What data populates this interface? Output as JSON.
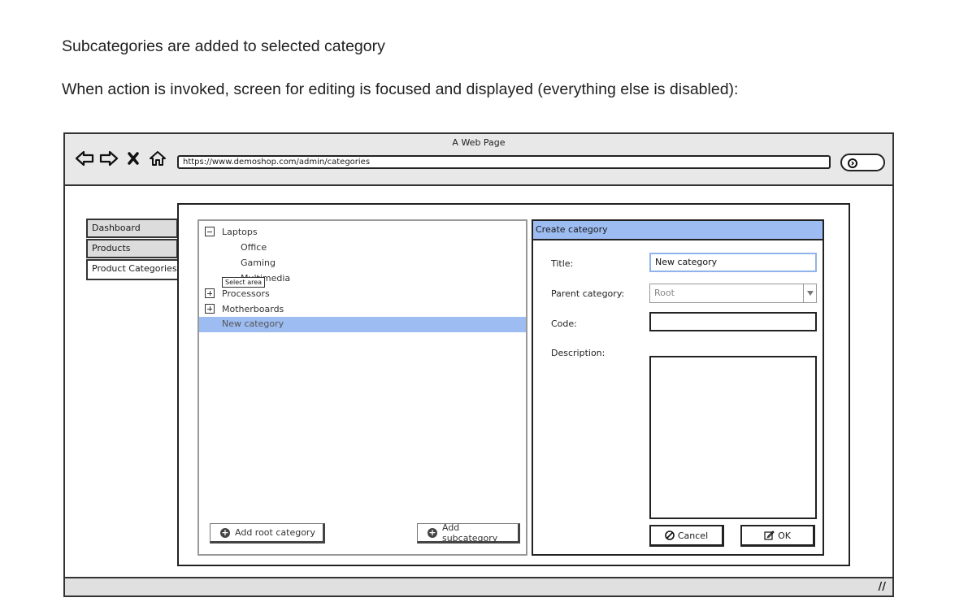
{
  "document": {
    "para1": "Subcategories are added to selected category",
    "para2": "When action is invoked, screen for editing is focused and displayed (everything else is disabled):"
  },
  "browser": {
    "title": "A Web Page",
    "url": "https://www.demoshop.com/admin/categories",
    "nav_icons": [
      "back-arrow-icon",
      "forward-arrow-icon",
      "close-x-icon",
      "home-icon"
    ],
    "resize_grip": "//"
  },
  "sidebar": {
    "tabs": [
      {
        "label": "Dashboard",
        "active": false
      },
      {
        "label": "Products",
        "active": false
      },
      {
        "label": "Product Categories",
        "active": true
      }
    ]
  },
  "tree": {
    "items": [
      {
        "label": "Laptops",
        "toggle": "minus"
      },
      {
        "label": "Office"
      },
      {
        "label": "Gaming"
      },
      {
        "label": "Multimedia"
      },
      {
        "label": "Processors",
        "toggle": "plus"
      },
      {
        "label": "Motherboards",
        "toggle": "plus"
      }
    ],
    "selected_item": "New category",
    "tooltip": "Select area",
    "add_root_label": "Add root category",
    "add_sub_label": "Add subcategory"
  },
  "dialog": {
    "title": "Create category",
    "title_label": "Title:",
    "title_value": "New category",
    "parent_label": "Parent category:",
    "parent_value": "Root",
    "code_label": "Code:",
    "code_value": "",
    "description_label": "Description:",
    "cancel_label": "Cancel",
    "ok_label": "OK"
  },
  "colors": {
    "selection": "#9dbcf2",
    "chrome": "#e8e8e8"
  }
}
